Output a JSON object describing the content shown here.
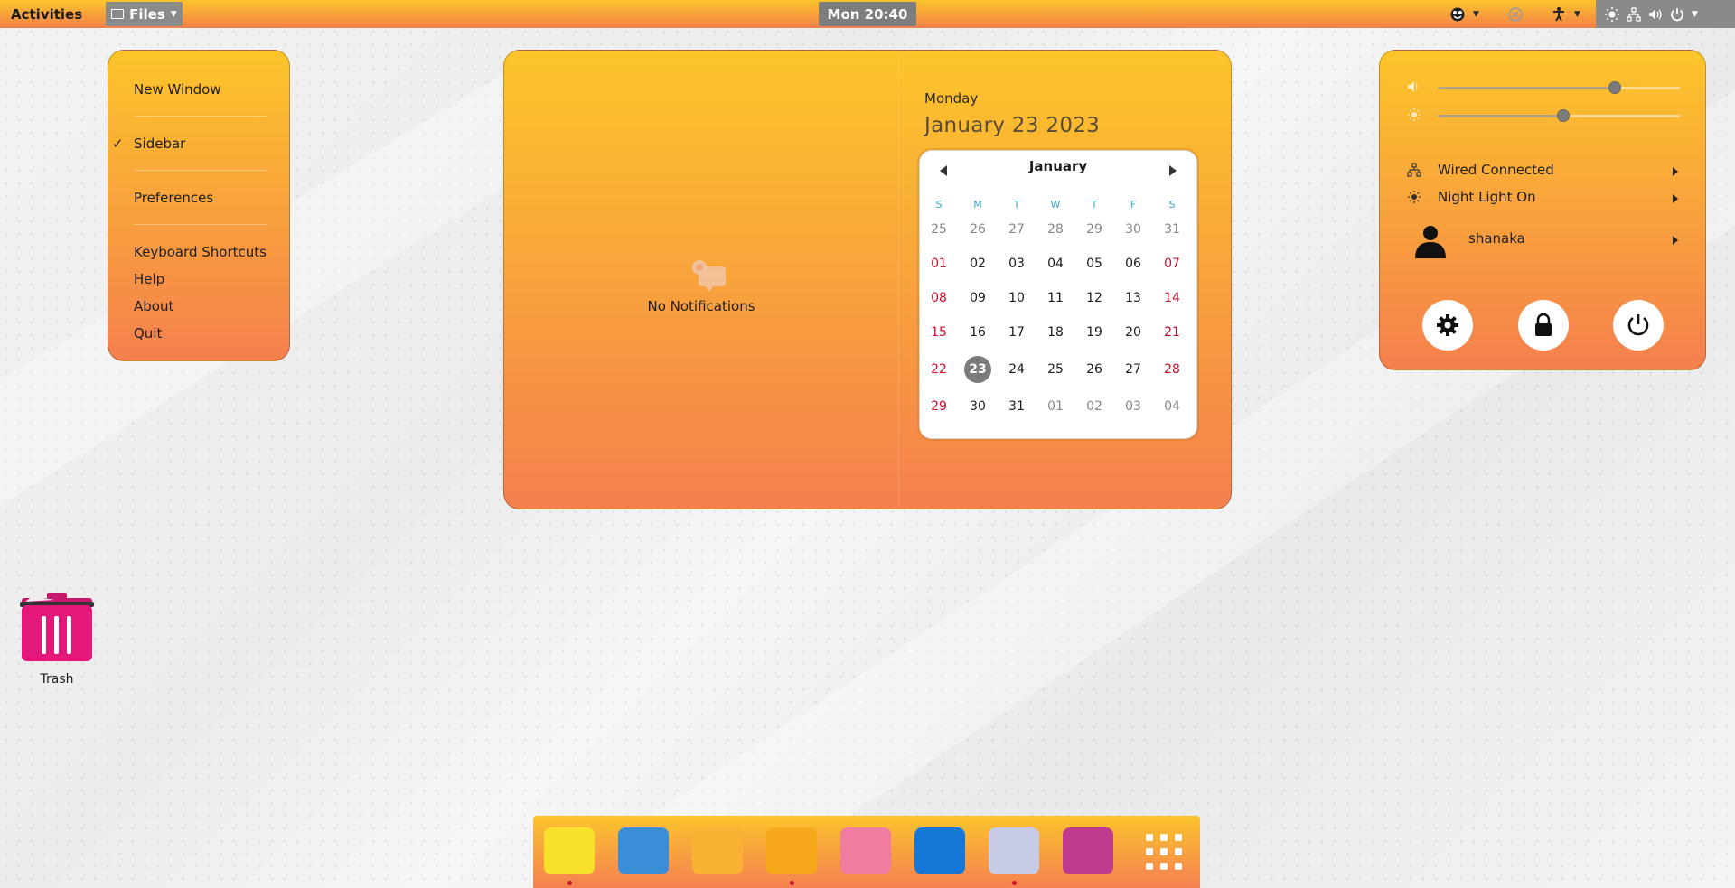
{
  "topbar": {
    "activities": "Activities",
    "app_name": "Files",
    "clock": "Mon 20:40"
  },
  "app_menu": {
    "items": [
      {
        "label": "New Window"
      },
      {
        "label": "Sidebar",
        "checked": true
      },
      {
        "label": "Preferences"
      },
      {
        "label": "Keyboard Shortcuts"
      },
      {
        "label": "Help"
      },
      {
        "label": "About"
      },
      {
        "label": "Quit"
      }
    ]
  },
  "notifications": {
    "empty_text": "No Notifications"
  },
  "calendar": {
    "day_name": "Monday",
    "full_date": "January 23 2023",
    "month": "January",
    "weekdays": [
      "S",
      "M",
      "T",
      "W",
      "T",
      "F",
      "S"
    ],
    "weeks": [
      [
        "25",
        "26",
        "27",
        "28",
        "29",
        "30",
        "31"
      ],
      [
        "01",
        "02",
        "03",
        "04",
        "05",
        "06",
        "07"
      ],
      [
        "08",
        "09",
        "10",
        "11",
        "12",
        "13",
        "14"
      ],
      [
        "15",
        "16",
        "17",
        "18",
        "19",
        "20",
        "21"
      ],
      [
        "22",
        "23",
        "24",
        "25",
        "26",
        "27",
        "28"
      ],
      [
        "29",
        "30",
        "31",
        "01",
        "02",
        "03",
        "04"
      ]
    ],
    "today": "23"
  },
  "system_menu": {
    "volume_level": 0.73,
    "brightness_level": 0.52,
    "rows": [
      {
        "label": "Wired Connected",
        "icon": "network-wired-icon"
      },
      {
        "label": "Night Light On",
        "icon": "night-light-icon"
      },
      {
        "label": "shanaka",
        "icon": "user-avatar-icon"
      }
    ]
  },
  "desktop": {
    "trash_label": "Trash"
  },
  "dock": {
    "apps": [
      {
        "name": "mixer-app",
        "color": "#f7e12b"
      },
      {
        "name": "thunderbird-app",
        "color": "#3a8ed8"
      },
      {
        "name": "mail-app",
        "color": "#f9b233"
      },
      {
        "name": "files-app",
        "color": "#f7a91b"
      },
      {
        "name": "tweaks-app",
        "color": "#f07ca0"
      },
      {
        "name": "word-app",
        "color": "#1678d6"
      },
      {
        "name": "text-editor-app",
        "color": "#c7cbe4"
      },
      {
        "name": "screenshot-app",
        "color": "#c03a8e"
      }
    ],
    "grid_icon": "app-grid-icon",
    "accent": "#c8102e"
  },
  "colors": {
    "panel_top": "#fcc42c",
    "panel_bottom": "#f4804a",
    "weekend": "#c8102e",
    "weekday_header": "#3aa7c8"
  }
}
